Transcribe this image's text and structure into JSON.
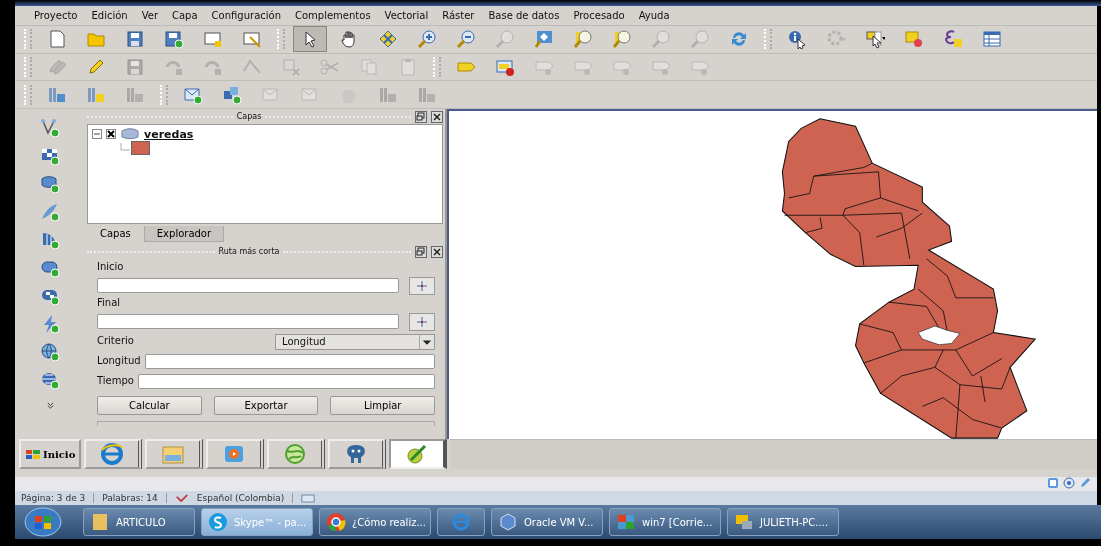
{
  "menu": [
    "Proyecto",
    "Edición",
    "Ver",
    "Capa",
    "Configuración",
    "Complementos",
    "Vectorial",
    "Ráster",
    "Base de datos",
    "Procesado",
    "Ayuda"
  ],
  "toolbars": [
    {
      "buttons": [
        {
          "disabled": false,
          "selected": false
        },
        {
          "disabled": false,
          "selected": false
        },
        {
          "disabled": false,
          "selected": false
        },
        {
          "disabled": false,
          "selected": false
        },
        {
          "disabled": false,
          "selected": false
        },
        {
          "disabled": false,
          "selected": false
        },
        {
          "disabled": false,
          "selected": true
        },
        {
          "disabled": false,
          "selected": false
        },
        {
          "disabled": false,
          "selected": false
        },
        {
          "disabled": false,
          "selected": false
        },
        {
          "disabled": false,
          "selected": false
        },
        {
          "disabled": true,
          "selected": false
        },
        {
          "disabled": false,
          "selected": false
        },
        {
          "disabled": false,
          "selected": false
        },
        {
          "disabled": false,
          "selected": false
        },
        {
          "disabled": true,
          "selected": false
        },
        {
          "disabled": true,
          "selected": false
        },
        {
          "disabled": false,
          "selected": false
        },
        {
          "disabled": false,
          "selected": false
        },
        {
          "disabled": true,
          "selected": false
        },
        {
          "disabled": false,
          "selected": false
        },
        {
          "disabled": false,
          "selected": false
        },
        {
          "disabled": false,
          "selected": false
        },
        {
          "disabled": false,
          "selected": false
        }
      ]
    },
    {
      "buttons": [
        {
          "disabled": true,
          "selected": false
        },
        {
          "disabled": false,
          "selected": false
        },
        {
          "disabled": true,
          "selected": false
        },
        {
          "disabled": true,
          "selected": false
        },
        {
          "disabled": true,
          "selected": false
        },
        {
          "disabled": true,
          "selected": false
        },
        {
          "disabled": true,
          "selected": false
        },
        {
          "disabled": true,
          "selected": false
        },
        {
          "disabled": true,
          "selected": false
        },
        {
          "disabled": true,
          "selected": false
        },
        {
          "disabled": false,
          "selected": false
        },
        {
          "disabled": false,
          "selected": false
        },
        {
          "disabled": true,
          "selected": false
        },
        {
          "disabled": true,
          "selected": false
        },
        {
          "disabled": true,
          "selected": false
        },
        {
          "disabled": true,
          "selected": false
        },
        {
          "disabled": true,
          "selected": false
        }
      ]
    },
    {
      "buttons": [
        {
          "disabled": false,
          "selected": false
        },
        {
          "disabled": false,
          "selected": false
        },
        {
          "disabled": true,
          "selected": false
        },
        {
          "disabled": false,
          "selected": false
        },
        {
          "disabled": false,
          "selected": false
        },
        {
          "disabled": true,
          "selected": false
        },
        {
          "disabled": true,
          "selected": false
        },
        {
          "disabled": true,
          "selected": false
        },
        {
          "disabled": true,
          "selected": false
        },
        {
          "disabled": true,
          "selected": false
        }
      ]
    }
  ],
  "layers_panel": {
    "title": "Capas",
    "tree": [
      {
        "label": "veredas",
        "checked": true,
        "expanded": true,
        "children": [
          {
            "kind": "symbol",
            "color": "#cd6350"
          }
        ]
      }
    ],
    "tabs": [
      {
        "label": "Capas",
        "selected": true
      },
      {
        "label": "Explorador",
        "selected": false
      }
    ]
  },
  "route_panel": {
    "title": "Ruta más corta",
    "start": {
      "label": "Inicio"
    },
    "end": {
      "label": "Final"
    },
    "criterion": {
      "label": "Criterio",
      "value": "Longitud"
    },
    "length": {
      "label": "Longitud"
    },
    "time": {
      "label": "Tiempo"
    },
    "buttons": [
      "Calcular",
      "Exportar",
      "Limpiar"
    ]
  },
  "inner_taskbar": {
    "start": "Inicio",
    "apps": [
      {
        "selected": false
      },
      {
        "selected": false
      },
      {
        "selected": false
      },
      {
        "selected": false
      },
      {
        "selected": false
      },
      {
        "selected": true
      }
    ]
  },
  "word_status": [
    "Página: 3 de 3",
    "Palabras: 14",
    "Español (Colombia)"
  ],
  "taskbar": {
    "buttons": [
      {
        "label": "ARTICULO",
        "selected": false
      },
      {
        "label": "Skype™ - pa...",
        "selected": true
      },
      {
        "label": "¿Cómo realiz...",
        "selected": false
      },
      {
        "selected": false
      },
      {
        "label": "Oracle VM V...",
        "selected": false
      },
      {
        "label": "win7 [Corrie...",
        "selected": false
      },
      {
        "label": "JULIETH-PC....",
        "selected": false
      }
    ]
  }
}
